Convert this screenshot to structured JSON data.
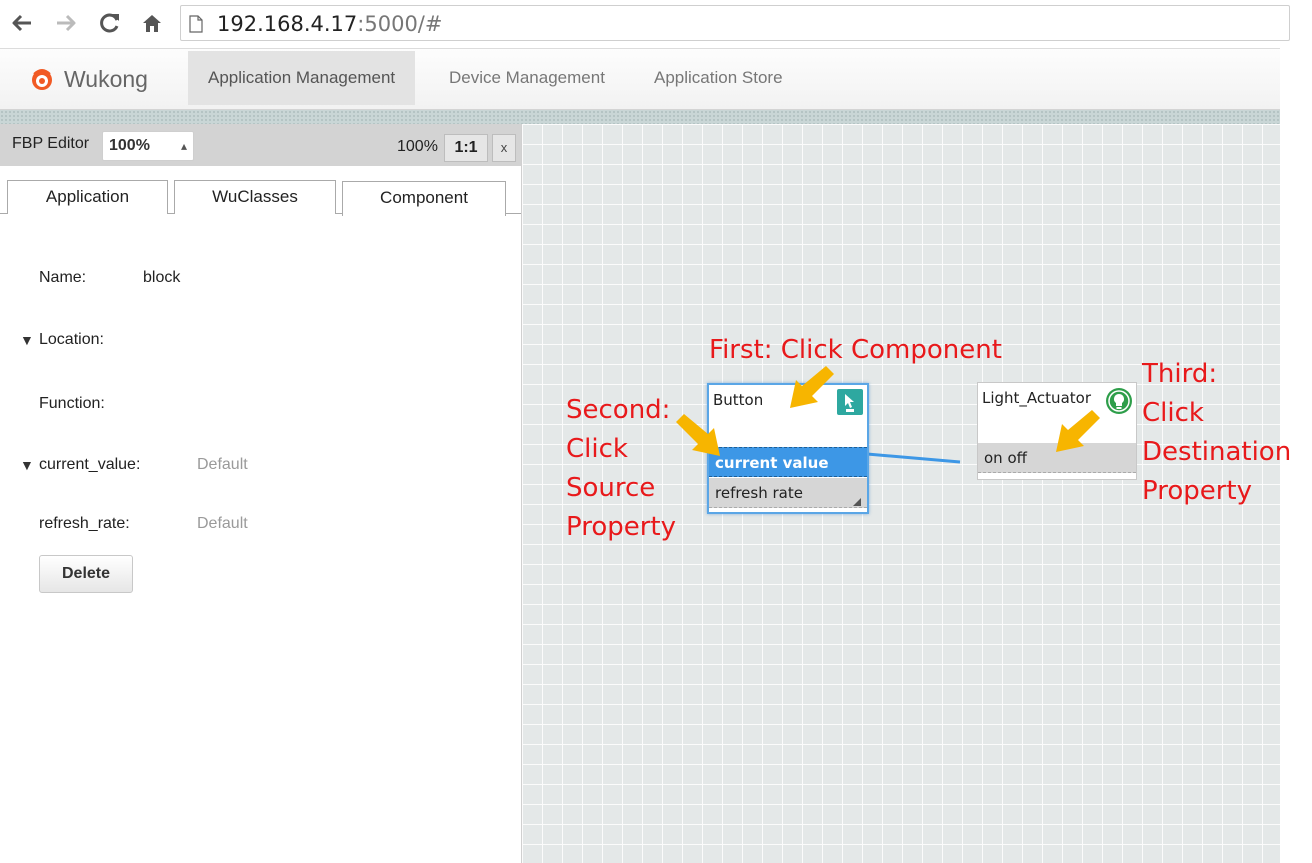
{
  "browser": {
    "url_host": "192.168.4.17",
    "url_rest": ":5000/#"
  },
  "app": {
    "brand": "Wukong",
    "nav": [
      {
        "label": "Application Management",
        "active": true
      },
      {
        "label": "Device Management",
        "active": false
      },
      {
        "label": "Application Store",
        "active": false
      }
    ]
  },
  "editor": {
    "title": "FBP Editor",
    "zoom_select": "100%",
    "zoom_level": "100%",
    "ratio_button": "1:1",
    "close_button": "x"
  },
  "tabs": [
    "Application",
    "WuClasses",
    "Component"
  ],
  "component_panel": {
    "name_label": "Name:",
    "name_value": "block",
    "location_label": "Location:",
    "function_label": "Function:",
    "current_value_label": "current_value:",
    "current_value_value": "Default",
    "refresh_rate_label": "refresh_rate:",
    "refresh_rate_value": "Default",
    "delete_button": "Delete"
  },
  "canvas": {
    "components": [
      {
        "title": "Button",
        "icon": "button-component-icon",
        "properties": [
          "current value",
          "refresh rate"
        ],
        "selected_property": "current value"
      },
      {
        "title": "Light_Actuator",
        "icon": "lightbulb-icon",
        "properties": [
          "on off"
        ]
      }
    ]
  },
  "annotations": {
    "first": "First: Click Component",
    "second": [
      "Second:",
      "Click",
      "Source",
      "Property"
    ],
    "third": [
      "Third:",
      "Click",
      "Destination",
      "Property"
    ]
  },
  "colors": {
    "annotation_text": "#e8191b",
    "arrow": "#f7b500",
    "selected_property": "#3d97e6",
    "link_line": "#3d97e6"
  }
}
